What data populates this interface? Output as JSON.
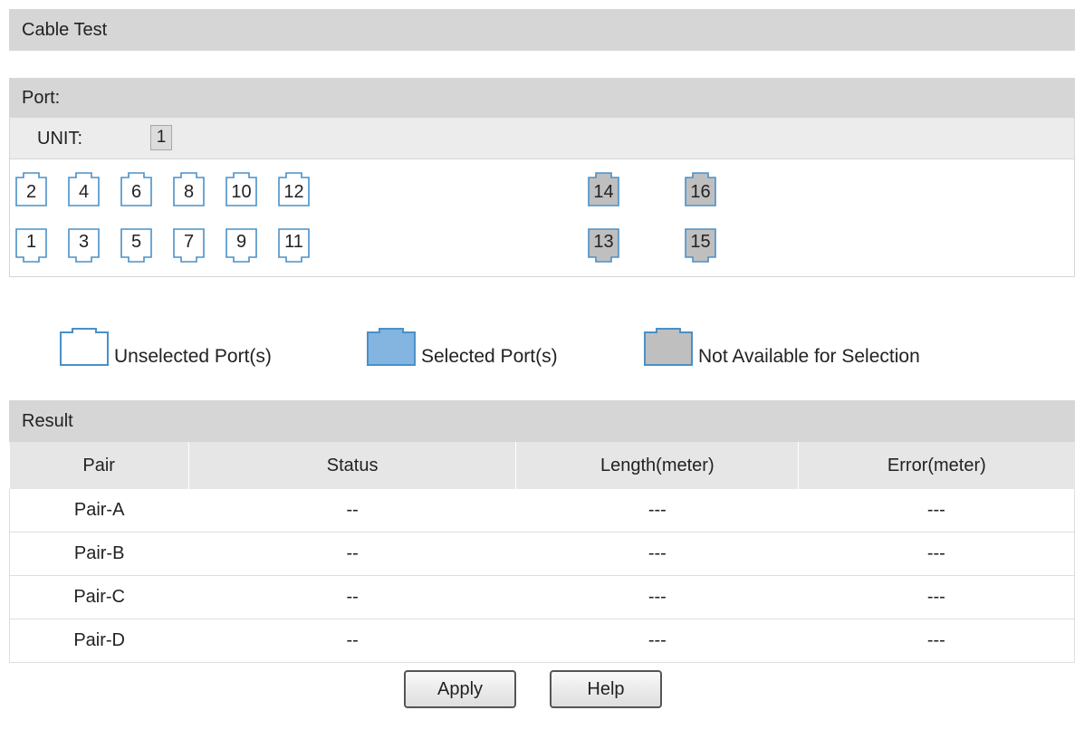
{
  "page": {
    "title": "Cable Test"
  },
  "port_section": {
    "header": "Port:",
    "unit_label": "UNIT:",
    "unit_value": "1",
    "top_row": [
      {
        "label": "2",
        "state": "unselected"
      },
      {
        "label": "4",
        "state": "unselected"
      },
      {
        "label": "6",
        "state": "unselected"
      },
      {
        "label": "8",
        "state": "unselected"
      },
      {
        "label": "10",
        "state": "unselected"
      },
      {
        "label": "12",
        "state": "unselected"
      },
      {
        "label": "14",
        "state": "not-available"
      },
      {
        "label": "16",
        "state": "not-available"
      }
    ],
    "bottom_row": [
      {
        "label": "1",
        "state": "unselected"
      },
      {
        "label": "3",
        "state": "unselected"
      },
      {
        "label": "5",
        "state": "unselected"
      },
      {
        "label": "7",
        "state": "unselected"
      },
      {
        "label": "9",
        "state": "unselected"
      },
      {
        "label": "11",
        "state": "unselected"
      },
      {
        "label": "13",
        "state": "not-available"
      },
      {
        "label": "15",
        "state": "not-available"
      }
    ]
  },
  "legend": {
    "unselected": "Unselected Port(s)",
    "selected": "Selected Port(s)",
    "not_available": "Not Available for Selection"
  },
  "result": {
    "header": "Result",
    "columns": [
      "Pair",
      "Status",
      "Length(meter)",
      "Error(meter)"
    ],
    "rows": [
      [
        "Pair-A",
        "--",
        "---",
        "---"
      ],
      [
        "Pair-B",
        "--",
        "---",
        "---"
      ],
      [
        "Pair-C",
        "--",
        "---",
        "---"
      ],
      [
        "Pair-D",
        "--",
        "---",
        "---"
      ]
    ]
  },
  "buttons": {
    "apply": "Apply",
    "help": "Help"
  },
  "colors": {
    "port_border": "#4a90c8",
    "port_unselected_fill": "#ffffff",
    "port_selected_fill": "#84b4e0",
    "port_unavailable_fill": "#bfbfbf",
    "header_bg": "#d6d6d6"
  }
}
